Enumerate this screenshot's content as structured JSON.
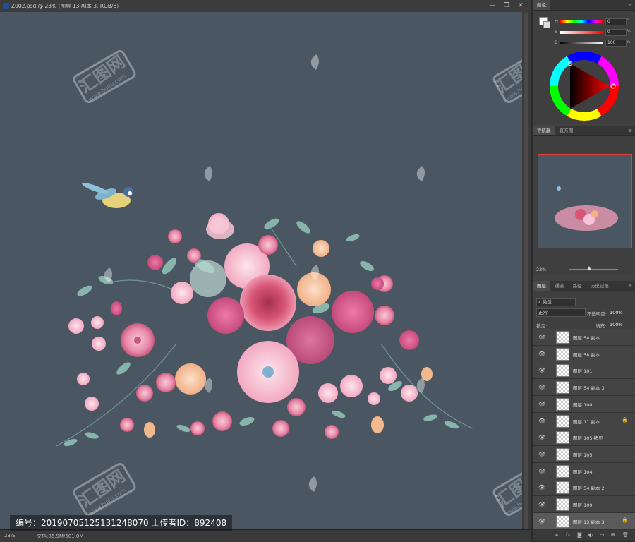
{
  "document": {
    "tab_title": "Z002.psd @ 23% (图层 13 副本 3, RGB/8)",
    "zoom": "23%",
    "doc_size": "文档:86.9M/501.0M",
    "window_controls": [
      "—",
      "❐",
      "✕"
    ]
  },
  "image_watermark": {
    "id_text": "编号：20190705125131248070 上传者ID：892408",
    "logo_text": "汇图网",
    "logo_url_text": "www.huitu.com"
  },
  "color_panel": {
    "tab": "颜色",
    "sliders": [
      {
        "label": "H",
        "value": "0",
        "unit": "°"
      },
      {
        "label": "S",
        "value": "0",
        "unit": "%"
      },
      {
        "label": "B",
        "value": "100",
        "unit": "%"
      }
    ]
  },
  "navigator_panel": {
    "tabs": [
      "导航器",
      "直方图"
    ],
    "zoom": "23%"
  },
  "layers_panel": {
    "tabs": [
      "图层",
      "通道",
      "路径",
      "历史记录"
    ],
    "filter_kind": "类型",
    "blend_mode": "正常",
    "opacity_label": "不透明度:",
    "opacity_value": "100%",
    "lock_label": "锁定:",
    "fill_label": "填充:",
    "fill_value": "100%",
    "layers": [
      {
        "name": "图层 54 副本",
        "locked": false
      },
      {
        "name": "图层 58 副本",
        "locked": false
      },
      {
        "name": "图层 101",
        "locked": false
      },
      {
        "name": "图层 54 副本 3",
        "locked": false
      },
      {
        "name": "图层 100",
        "locked": false
      },
      {
        "name": "图层 11 副本",
        "locked": true
      },
      {
        "name": "图层 105 拷贝",
        "locked": false
      },
      {
        "name": "图层 105",
        "locked": false
      },
      {
        "name": "图层 104",
        "locked": false
      },
      {
        "name": "图层 54 副本 2",
        "locked": false
      },
      {
        "name": "图层 109",
        "locked": false
      },
      {
        "name": "图层 13 副本 3",
        "locked": true,
        "selected": true
      }
    ],
    "footer_icons": [
      "link-icon",
      "fx-icon",
      "mask-icon",
      "adjustment-icon",
      "folder-icon",
      "new-layer-icon",
      "trash-icon"
    ]
  },
  "colors": {
    "canvas_bg": "#4a5662",
    "accent_red": "#e0423a"
  }
}
